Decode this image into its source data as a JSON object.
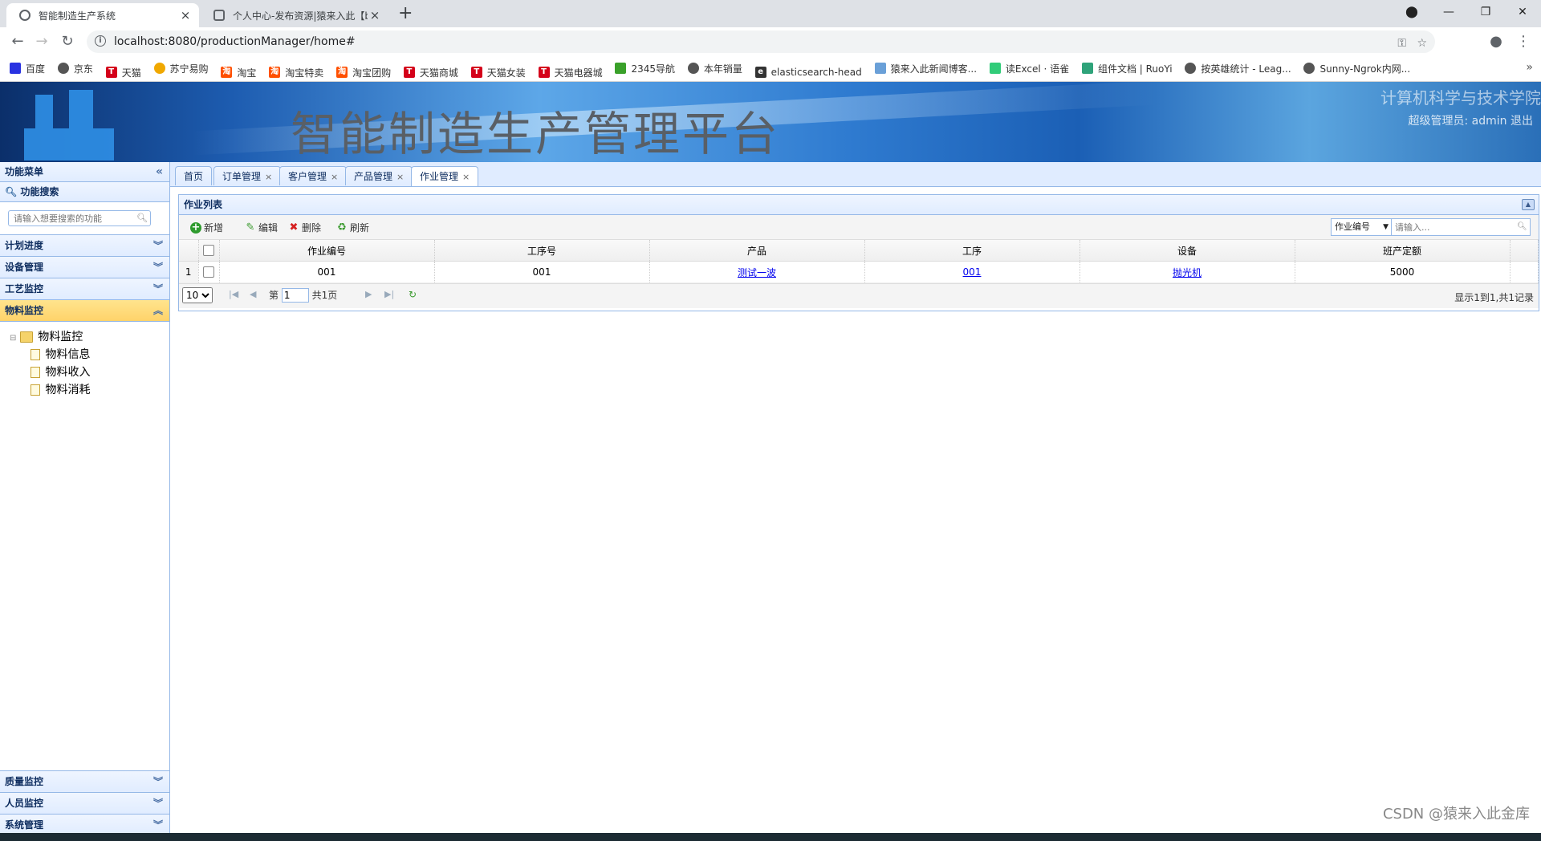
{
  "browser": {
    "tabs": [
      {
        "title": "智能制造生产系统",
        "active": true
      },
      {
        "title": "个人中心-发布资源|猿来入此【b",
        "active": false
      }
    ],
    "new_tab": "+",
    "url": "localhost:8080/productionManager/home#",
    "bookmarks": [
      {
        "label": "百度",
        "icon": "paw-icon",
        "color": "#2932e1"
      },
      {
        "label": "京东",
        "icon": "globe-icon",
        "color": "#555555"
      },
      {
        "label": "天猫",
        "icon": "tmall-icon",
        "color": "#d4001a"
      },
      {
        "label": "苏宁易购",
        "icon": "suning-icon",
        "color": "#f0a800"
      },
      {
        "label": "淘宝",
        "icon": "taobao-icon",
        "color": "#ff5000"
      },
      {
        "label": "淘宝特卖",
        "icon": "taobao-icon",
        "color": "#ff5000"
      },
      {
        "label": "淘宝团购",
        "icon": "taobao-icon",
        "color": "#ff5000"
      },
      {
        "label": "天猫商城",
        "icon": "tmall-icon",
        "color": "#d4001a"
      },
      {
        "label": "天猫女装",
        "icon": "tmall-icon",
        "color": "#d4001a"
      },
      {
        "label": "天猫电器城",
        "icon": "tmall-icon",
        "color": "#d4001a"
      },
      {
        "label": "2345导航",
        "icon": "nav-icon",
        "color": "#3aa12a"
      },
      {
        "label": "本年销量",
        "icon": "globe-icon",
        "color": "#555555"
      },
      {
        "label": "elasticsearch-head",
        "icon": "es-icon",
        "color": "#333333"
      },
      {
        "label": "猿来入此新闻博客...",
        "icon": "ylrc-icon",
        "color": "#6aa0d8"
      },
      {
        "label": "读Excel · 语雀",
        "icon": "yuque-icon",
        "color": "#31cc79"
      },
      {
        "label": "组件文档 | RuoYi",
        "icon": "ruoyi-icon",
        "color": "#2fa37a"
      },
      {
        "label": "按英雄统计 - Leag...",
        "icon": "globe-icon",
        "color": "#555555"
      },
      {
        "label": "Sunny-Ngrok内网...",
        "icon": "globe-icon",
        "color": "#555555"
      }
    ],
    "bookmarks_more": "»"
  },
  "banner": {
    "system_name": "智能制造生产管理平台",
    "school": "计算机科学与技术学院",
    "user_text": "超级管理员: admin 退出"
  },
  "sidebar": {
    "title": "功能菜单",
    "search_section": "功能搜索",
    "search_placeholder": "请输入想要搜索的功能",
    "sections_top": [
      {
        "label": "计划进度",
        "selected": false
      },
      {
        "label": "设备管理",
        "selected": false
      },
      {
        "label": "工艺监控",
        "selected": false
      },
      {
        "label": "物料监控",
        "selected": true
      }
    ],
    "tree": {
      "root": "物料监控",
      "children": [
        "物料信息",
        "物料收入",
        "物料消耗"
      ]
    },
    "sections_bottom": [
      {
        "label": "质量监控"
      },
      {
        "label": "人员监控"
      },
      {
        "label": "系统管理"
      }
    ]
  },
  "content_tabs": [
    {
      "label": "首页",
      "closable": false,
      "active": false
    },
    {
      "label": "订单管理",
      "closable": true,
      "active": false
    },
    {
      "label": "客户管理",
      "closable": true,
      "active": false
    },
    {
      "label": "产品管理",
      "closable": true,
      "active": false
    },
    {
      "label": "作业管理",
      "closable": true,
      "active": true
    }
  ],
  "grid": {
    "title": "作业列表",
    "buttons": {
      "add": "新增",
      "edit": "编辑",
      "delete": "删除",
      "refresh": "刷新"
    },
    "search_field": "作业编号",
    "search_placeholder": "请输入...",
    "columns": [
      "作业编号",
      "工序号",
      "产品",
      "工序",
      "设备",
      "班产定额"
    ],
    "rows": [
      {
        "num": "1",
        "cells": [
          "001",
          "001",
          "测试一波",
          "001",
          "抛光机",
          "5000"
        ],
        "links": [
          false,
          false,
          true,
          true,
          true,
          false
        ]
      }
    ],
    "pager": {
      "page_size": "10",
      "page_prefix": "第",
      "page_value": "1",
      "page_suffix": "共1页",
      "info": "显示1到1,共1记录"
    }
  },
  "watermark": "CSDN @猿来入此金库",
  "colors": {
    "accent": "#95b8e7",
    "selected": "#ffd36a",
    "link": "#0000ee"
  }
}
